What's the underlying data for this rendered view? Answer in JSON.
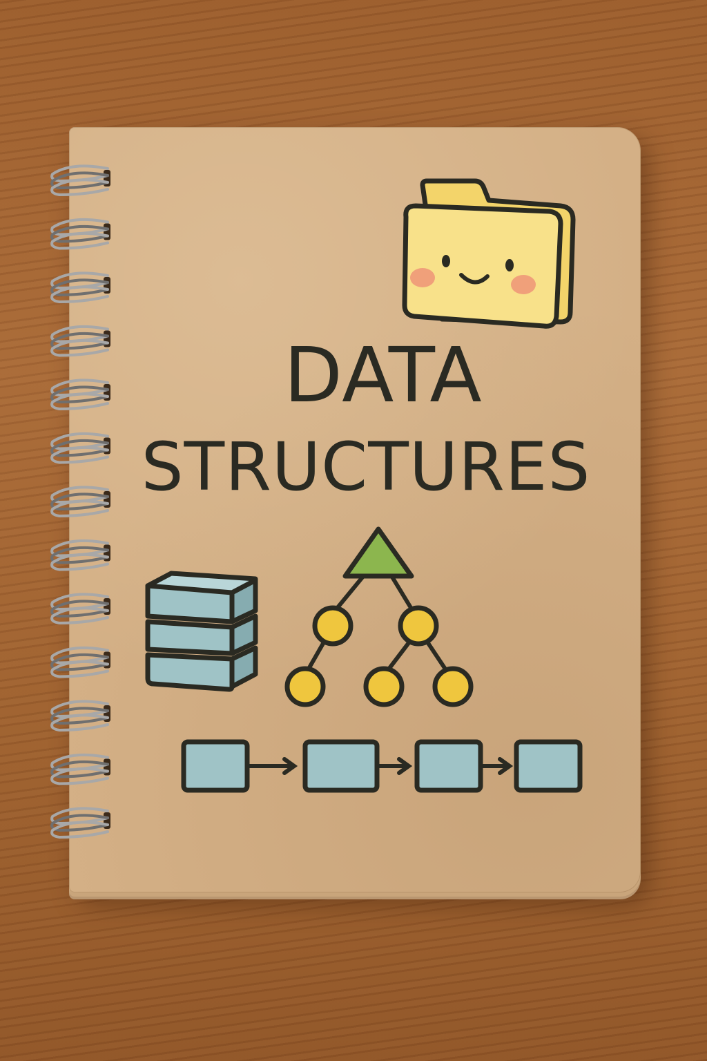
{
  "cover": {
    "title_line1": "DATA",
    "title_line2": "STRUCTURES"
  },
  "icons": {
    "folder": "smiling-folder-icon",
    "stack": "stacked-blocks-icon",
    "tree": "binary-tree-icon",
    "list": "linked-list-icon"
  },
  "colors": {
    "kraft_cover": "#d4b086",
    "wood_desk": "#9a5d2d",
    "ink": "#2a2a22",
    "folder_yellow": "#f5da72",
    "blush": "#f0a07a",
    "block_blue": "#9fc3c6",
    "node_yellow": "#efc63e",
    "root_green": "#8cb64e",
    "spiral_metal": "#9a9a9a"
  }
}
